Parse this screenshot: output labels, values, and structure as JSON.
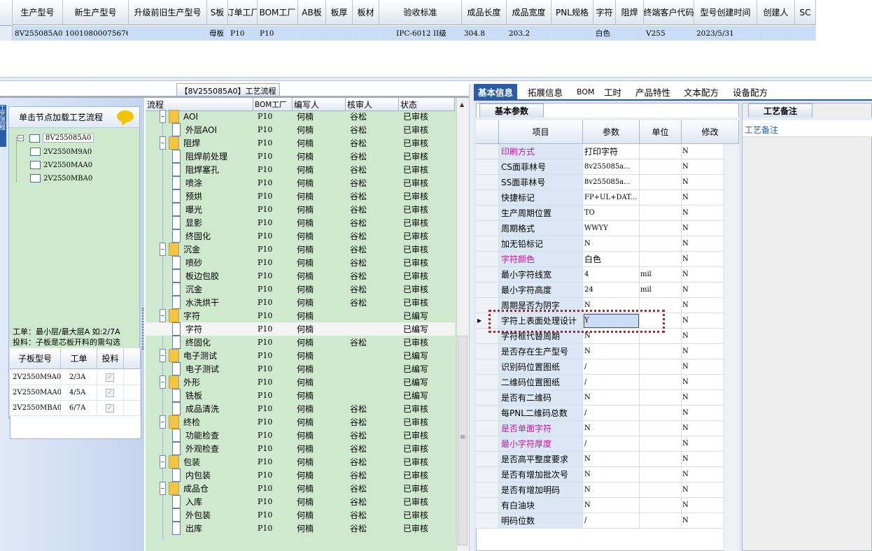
{
  "top_grid": {
    "headers": [
      "生产型号",
      "新生产型号",
      "升级前旧生产型号",
      "S板",
      "订单工厂",
      "BOM工厂",
      "AB板",
      "板厚",
      "板材",
      "验收标准",
      "成品长度",
      "成品宽度",
      "PNL规格",
      "字符",
      "阻焊",
      "终端客户代码",
      "型号创建时间",
      "创建人",
      "SC"
    ],
    "row": [
      "8V255085A0",
      "10010800075676",
      "",
      "母板",
      "P10",
      "P10",
      "",
      "",
      "",
      "IPC-6012 II级",
      "304.8",
      "203.2",
      "",
      "白色",
      "",
      "V255",
      "2023/5/31",
      "",
      ""
    ]
  },
  "left": {
    "flow_tab_title": "【8V255085A0】工艺流程",
    "side_label": "工艺流程",
    "tree_hint": "单击节点加载工艺流程",
    "tree": {
      "root": "8V255085A0",
      "children": [
        "2V2550M9A0",
        "2V2550MAA0",
        "2V2550MBA0"
      ]
    },
    "note_line1": "工单：最小层/最大层A 如:2/7A",
    "note_line2": "投料：子板是芯板开料的需勾选",
    "sub_headers": [
      "子板型号",
      "工单",
      "投料"
    ],
    "sub_rows": [
      {
        "model": "2V2550M9A0",
        "order": "2/3A",
        "feed": "✓"
      },
      {
        "model": "2V2550MAA0",
        "order": "4/5A",
        "feed": "✓"
      },
      {
        "model": "2V2550MBA0",
        "order": "6/7A",
        "feed": "✓"
      }
    ]
  },
  "process": {
    "headers": [
      "流程",
      "BOM工厂",
      "编写人",
      "核审人",
      "状态"
    ],
    "rows": [
      {
        "name": "AOI",
        "level": 0,
        "bom": "P10",
        "writer": "何楠",
        "reviewer": "谷松",
        "status": "已审核"
      },
      {
        "name": "外层AOI",
        "level": 1,
        "bom": "P10",
        "writer": "何楠",
        "reviewer": "谷松",
        "status": "已审核"
      },
      {
        "name": "阻焊",
        "level": 0,
        "bom": "P10",
        "writer": "何楠",
        "reviewer": "谷松",
        "status": "已审核"
      },
      {
        "name": "阻焊前处理",
        "level": 1,
        "bom": "P10",
        "writer": "何楠",
        "reviewer": "谷松",
        "status": "已审核"
      },
      {
        "name": "阻焊塞孔",
        "level": 1,
        "bom": "P10",
        "writer": "何楠",
        "reviewer": "谷松",
        "status": "已审核"
      },
      {
        "name": "喷涂",
        "level": 1,
        "bom": "P10",
        "writer": "何楠",
        "reviewer": "谷松",
        "status": "已审核"
      },
      {
        "name": "预烘",
        "level": 1,
        "bom": "P10",
        "writer": "何楠",
        "reviewer": "谷松",
        "status": "已审核"
      },
      {
        "name": "曝光",
        "level": 1,
        "bom": "P10",
        "writer": "何楠",
        "reviewer": "谷松",
        "status": "已审核"
      },
      {
        "name": "显影",
        "level": 1,
        "bom": "P10",
        "writer": "何楠",
        "reviewer": "谷松",
        "status": "已审核"
      },
      {
        "name": "终固化",
        "level": 1,
        "bom": "P10",
        "writer": "何楠",
        "reviewer": "谷松",
        "status": "已审核"
      },
      {
        "name": "沉金",
        "level": 0,
        "bom": "P10",
        "writer": "何楠",
        "reviewer": "谷松",
        "status": "已审核"
      },
      {
        "name": "喷砂",
        "level": 1,
        "bom": "P10",
        "writer": "何楠",
        "reviewer": "谷松",
        "status": "已审核"
      },
      {
        "name": "板边包胶",
        "level": 1,
        "bom": "P10",
        "writer": "何楠",
        "reviewer": "谷松",
        "status": "已审核"
      },
      {
        "name": "沉金",
        "level": 1,
        "bom": "P10",
        "writer": "何楠",
        "reviewer": "谷松",
        "status": "已审核"
      },
      {
        "name": "水洗烘干",
        "level": 1,
        "bom": "P10",
        "writer": "何楠",
        "reviewer": "谷松",
        "status": "已审核"
      },
      {
        "name": "字符",
        "level": 0,
        "bom": "P10",
        "writer": "何楠",
        "reviewer": "",
        "status": "已编写"
      },
      {
        "name": "字符",
        "level": 1,
        "bom": "P10",
        "writer": "何楠",
        "reviewer": "",
        "status": "已编写",
        "selected": true
      },
      {
        "name": "终固化",
        "level": 1,
        "bom": "P10",
        "writer": "何楠",
        "reviewer": "谷松",
        "status": "已审核"
      },
      {
        "name": "电子测试",
        "level": 0,
        "bom": "P10",
        "writer": "何楠",
        "reviewer": "",
        "status": "已编写"
      },
      {
        "name": "电子测试",
        "level": 1,
        "bom": "P10",
        "writer": "何楠",
        "reviewer": "",
        "status": "已编写"
      },
      {
        "name": "外形",
        "level": 0,
        "bom": "P10",
        "writer": "何楠",
        "reviewer": "",
        "status": "已编写"
      },
      {
        "name": "铣板",
        "level": 1,
        "bom": "P10",
        "writer": "何楠",
        "reviewer": "",
        "status": "已编写"
      },
      {
        "name": "成品清洗",
        "level": 1,
        "bom": "P10",
        "writer": "何楠",
        "reviewer": "谷松",
        "status": "已审核"
      },
      {
        "name": "终检",
        "level": 0,
        "bom": "P10",
        "writer": "何楠",
        "reviewer": "谷松",
        "status": "已审核"
      },
      {
        "name": "功能检查",
        "level": 1,
        "bom": "P10",
        "writer": "何楠",
        "reviewer": "谷松",
        "status": "已审核"
      },
      {
        "name": "外观检查",
        "level": 1,
        "bom": "P10",
        "writer": "何楠",
        "reviewer": "谷松",
        "status": "已审核"
      },
      {
        "name": "包装",
        "level": 0,
        "bom": "P10",
        "writer": "何楠",
        "reviewer": "谷松",
        "status": "已审核"
      },
      {
        "name": "内包装",
        "level": 1,
        "bom": "P10",
        "writer": "何楠",
        "reviewer": "谷松",
        "status": "已审核"
      },
      {
        "name": "成品仓",
        "level": 0,
        "bom": "P10",
        "writer": "何楠",
        "reviewer": "谷松",
        "status": "已审核"
      },
      {
        "name": "入库",
        "level": 1,
        "bom": "P10",
        "writer": "何楠",
        "reviewer": "谷松",
        "status": "已审核"
      },
      {
        "name": "外包装",
        "level": 1,
        "bom": "P10",
        "writer": "何楠",
        "reviewer": "谷松",
        "status": "已审核"
      },
      {
        "name": "出库",
        "level": 1,
        "bom": "P10",
        "writer": "何楠",
        "reviewer": "谷松",
        "status": "已审核"
      }
    ]
  },
  "right": {
    "tabs": [
      "基本信息",
      "拓展信息",
      "BOM",
      "工时",
      "产品特性",
      "文本配方",
      "设备配方"
    ],
    "sub_tab": "基本参数",
    "remark_tab": "工艺备注",
    "remark_label": "工艺备注",
    "headers": [
      "项目",
      "参数",
      "单位",
      "修改"
    ],
    "rows": [
      {
        "item": "印刷方式",
        "param": "打印字符",
        "unit": "",
        "mod": "N",
        "magenta": true
      },
      {
        "item": "CS面菲林号",
        "param": "8v255085a...",
        "unit": "",
        "mod": "N"
      },
      {
        "item": "SS面菲林号",
        "param": "8v255085a...",
        "unit": "",
        "mod": "N"
      },
      {
        "item": "快捷标记",
        "param": "FP+UL+DAT...",
        "unit": "",
        "mod": "N"
      },
      {
        "item": "生产周期位置",
        "param": "TO",
        "unit": "",
        "mod": "N"
      },
      {
        "item": "周期格式",
        "param": "WWYY",
        "unit": "",
        "mod": "N"
      },
      {
        "item": "加无铅标记",
        "param": "N",
        "unit": "",
        "mod": "N"
      },
      {
        "item": "字符颜色",
        "param": "白色",
        "unit": "",
        "mod": "N",
        "magenta": true
      },
      {
        "item": "最小字符线宽",
        "param": "4",
        "unit": "mil",
        "mod": "N"
      },
      {
        "item": "最小字符高度",
        "param": "24",
        "unit": "mil",
        "mod": "N"
      },
      {
        "item": "周期是否为阴字",
        "param": "N",
        "unit": "",
        "mod": "N"
      },
      {
        "item": "字符上表面处理设计",
        "param": "Y",
        "unit": "",
        "mod": "N",
        "current": true
      },
      {
        "item": "字符框代替周期",
        "param": "N",
        "unit": "",
        "mod": "N"
      },
      {
        "item": "是否存在生产型号",
        "param": "N",
        "unit": "",
        "mod": "N"
      },
      {
        "item": "识别码位置图纸",
        "param": "/",
        "unit": "",
        "mod": "N"
      },
      {
        "item": "二维码位置图纸",
        "param": "/",
        "unit": "",
        "mod": "N"
      },
      {
        "item": "是否有二维码",
        "param": "N",
        "unit": "",
        "mod": "N"
      },
      {
        "item": "每PNL二维码总数",
        "param": "/",
        "unit": "",
        "mod": "N"
      },
      {
        "item": "是否单面字符",
        "param": "N",
        "unit": "",
        "mod": "N",
        "magenta": true
      },
      {
        "item": "最小字符厚度",
        "param": "/",
        "unit": "",
        "mod": "N",
        "magenta": true
      },
      {
        "item": "是否高平整度要求",
        "param": "N",
        "unit": "",
        "mod": "N"
      },
      {
        "item": "是否有增加批次号",
        "param": "N",
        "unit": "",
        "mod": "N"
      },
      {
        "item": "是否有增加明码",
        "param": "N",
        "unit": "",
        "mod": "N"
      },
      {
        "item": "有白油块",
        "param": "N",
        "unit": "",
        "mod": "N"
      },
      {
        "item": "明码位数",
        "param": "/",
        "unit": "",
        "mod": "N"
      }
    ]
  },
  "colors": {
    "green_bg": "#cfe9cf",
    "selection_blue": "#c9def6",
    "tab_active": "#2a5ca8",
    "highlight_red": "#e01010",
    "magenta": "#c2189d"
  }
}
